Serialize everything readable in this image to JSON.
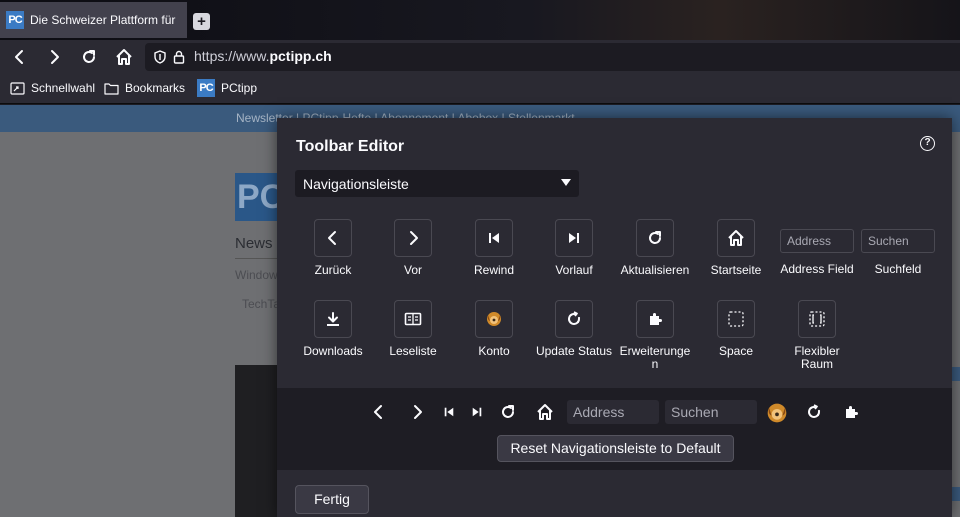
{
  "browser": {
    "tab_title": "Die Schweizer Plattform für",
    "tab_favicon_text": "PC",
    "url_prefix": "https://www.",
    "url_domain": "pctipp.ch",
    "bookmarks": [
      {
        "label": "Schnellwahl",
        "icon": "speed-dial-icon"
      },
      {
        "label": "Bookmarks",
        "icon": "folder-icon"
      },
      {
        "label": "PCtipp",
        "icon": "pctipp-logo-icon"
      }
    ]
  },
  "page": {
    "nav_text": "Newsletter  |  PCtipp-Hefte  |  Abonnement  |  Abobox  |  Stellenmarkt",
    "logo_text": "PC",
    "news_heading": "News",
    "sub1": "Windows",
    "sub2": "TechTalk"
  },
  "dialog": {
    "title": "Toolbar Editor",
    "help_symbol": "?",
    "selected_toolbar": "Navigationsleiste",
    "palette": [
      {
        "label": "Zurück",
        "icon": "back-icon"
      },
      {
        "label": "Vor",
        "icon": "forward-icon"
      },
      {
        "label": "Rewind",
        "icon": "rewind-icon"
      },
      {
        "label": "Vorlauf",
        "icon": "fast-forward-icon"
      },
      {
        "label": "Aktualisieren",
        "icon": "reload-icon"
      },
      {
        "label": "Startseite",
        "icon": "home-icon"
      },
      {
        "label": "Address Field",
        "field_text": "Address"
      },
      {
        "label": "Suchfeld",
        "field_text": "Suchen"
      },
      {
        "label": "Downloads",
        "icon": "download-icon"
      },
      {
        "label": "Leseliste",
        "icon": "reading-list-icon"
      },
      {
        "label": "Konto",
        "icon": "account-avatar-icon"
      },
      {
        "label": "Update Status",
        "icon": "update-status-icon"
      },
      {
        "label": "Erweiterunge\nn",
        "icon": "extensions-icon"
      },
      {
        "label": "Space",
        "icon": "space-icon"
      },
      {
        "label": "Flexibler\nRaum",
        "icon": "flexible-space-icon"
      }
    ],
    "preview": {
      "address_placeholder": "Address",
      "search_placeholder": "Suchen"
    },
    "reset_label": "Reset Navigationsleiste to Default",
    "done_label": "Fertig"
  },
  "colors": {
    "accent": "#3b7bc4",
    "dialog_bg": "#2b2a33",
    "chrome_bg": "#2b2a33"
  }
}
